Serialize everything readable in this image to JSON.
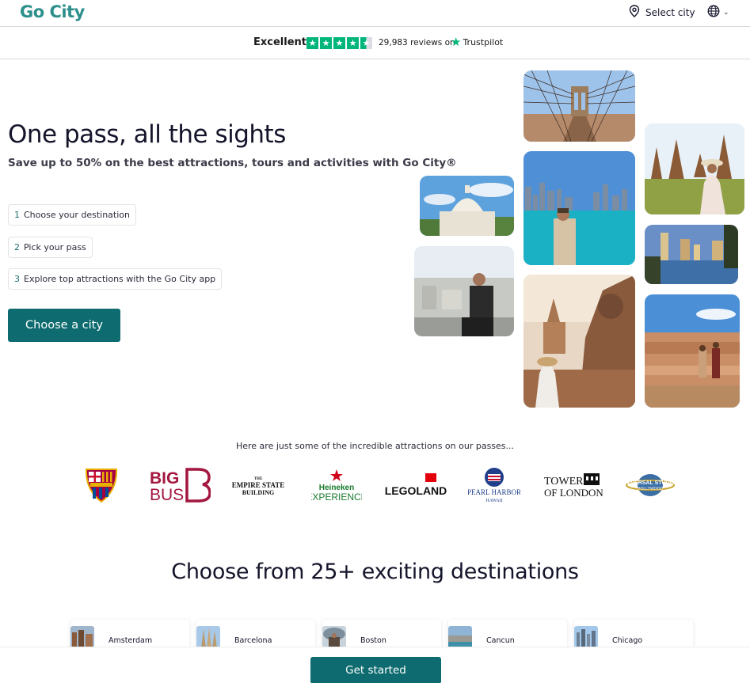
{
  "header": {
    "logo": "Go City",
    "select_city": "Select city",
    "icons": {
      "location": "map-pin-icon",
      "language": "globe-icon",
      "chevron": "chevron-down-icon"
    }
  },
  "trustpilot": {
    "rating_word": "Excellent",
    "review_count": "29,983 reviews on",
    "brand": "Trustpilot",
    "stars": 4.5,
    "star_color": "#00b67a"
  },
  "hero": {
    "title": "One pass, all the sights",
    "subtitle": "Save up to 50% on the best attractions, tours and activities with Go City®",
    "steps": [
      {
        "num": "1",
        "label": "Choose your destination"
      },
      {
        "num": "2",
        "label": "Pick your pass"
      },
      {
        "num": "3",
        "label": "Explore top attractions with the Go City app"
      }
    ],
    "cta": "Choose a city"
  },
  "photos": [
    "brooklyn-bridge",
    "capitol-dome",
    "chicago-skyline",
    "thai-temple",
    "las-vegas",
    "tourist-selfie",
    "buddha-statue",
    "grand-canyon"
  ],
  "attractions": {
    "caption": "Here are just some of the incredible attractions on our passes...",
    "logos": [
      {
        "name": "fc-barcelona",
        "text": "FCB"
      },
      {
        "name": "big-bus",
        "text": "BIG BUS"
      },
      {
        "name": "empire-state-building",
        "text": "THE EMPIRE STATE BUILDING"
      },
      {
        "name": "heineken-experience",
        "text": "Heineken EXPERIENCE"
      },
      {
        "name": "legoland",
        "text": "LEGOLAND"
      },
      {
        "name": "pearl-harbor",
        "text": "PEARL HARBOR HAWAII"
      },
      {
        "name": "tower-of-london",
        "text": "TOWER OF LONDON"
      },
      {
        "name": "universal-studios",
        "text": "UNIVERSAL STUDIOS HOLLYWOOD"
      }
    ]
  },
  "destinations": {
    "title": "Choose from 25+ exciting destinations",
    "cities": [
      "Amsterdam",
      "Barcelona",
      "Boston",
      "Cancun",
      "Chicago"
    ]
  },
  "footer": {
    "cta": "Get started"
  },
  "colors": {
    "brand_teal": "#0e6b6f",
    "logo_teal": "#2d8f8c",
    "text_dark": "#14142b"
  }
}
